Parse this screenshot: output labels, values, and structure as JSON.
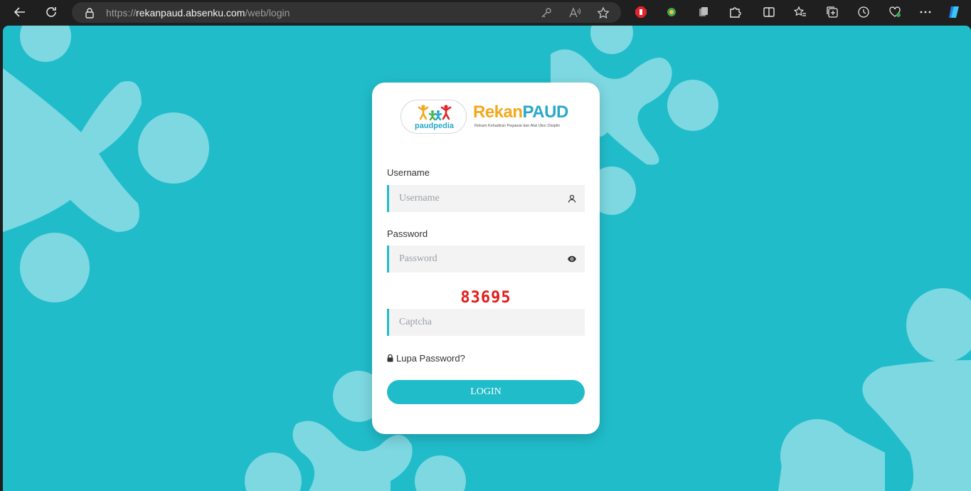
{
  "browser": {
    "url_scheme": "https://",
    "url_host": "rekanpaud.absenku.com",
    "url_path": "/web/login"
  },
  "brand": {
    "partner_logo_text": "paudpedia",
    "title_part1": "Rekan",
    "title_part2": "PAUD",
    "tagline": "Rekam Kehadiran Pegawai dan Alat Ukur Disiplin"
  },
  "form": {
    "username_label": "Username",
    "username_placeholder": "Username",
    "password_label": "Password",
    "password_placeholder": "Password",
    "captcha_code": "83695",
    "captcha_placeholder": "Captcha",
    "forgot_label": "Lupa Password?",
    "login_label": "LOGIN"
  },
  "colors": {
    "background": "#21bcca",
    "shape": "#7dd8e1",
    "captcha": "#e41b1b",
    "brand_orange": "#f4a81d",
    "brand_blue": "#2aa8c9"
  }
}
